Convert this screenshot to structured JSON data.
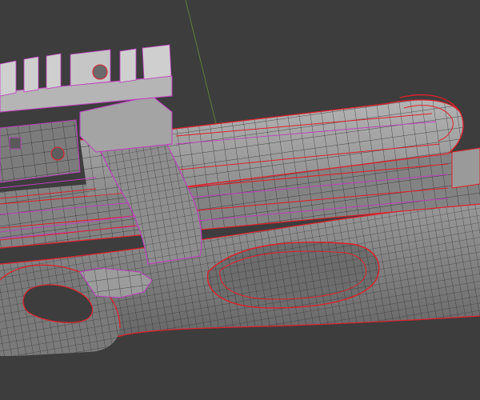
{
  "viewport": {
    "background_color": "#3d3d3d",
    "axis_line_color": "#5f7d3a",
    "mesh_fill_color": "#8a8a8a",
    "mesh_dark_color": "#6b6b6b",
    "mesh_light_color": "#a9a9a9",
    "wire_color": "#2a2a2a",
    "seam_color": "#e0202a",
    "selected_edge_color": "#c03cc0"
  },
  "subject": {
    "description_icon": "3d-wireframe-gun-mesh-icon"
  }
}
